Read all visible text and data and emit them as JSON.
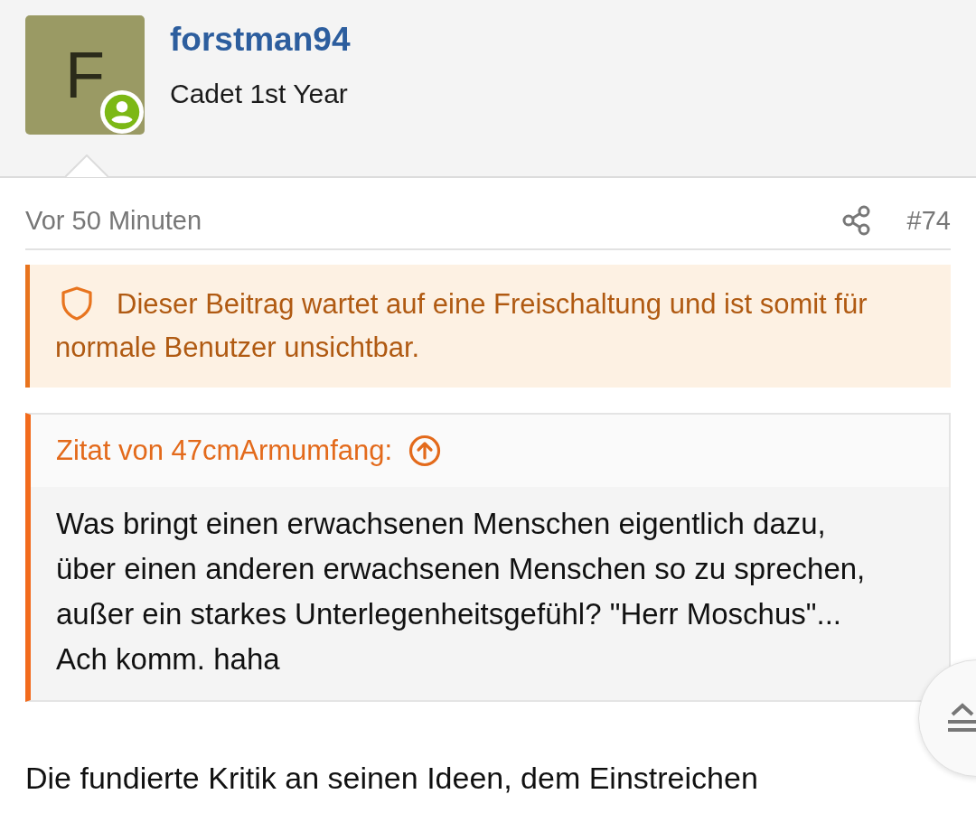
{
  "author": {
    "avatar_letter": "F",
    "online": true,
    "name": "forstman94",
    "rank": "Cadet 1st Year"
  },
  "post": {
    "time": "Vor 50 Minuten",
    "number": "#74",
    "notice": "Dieser Beitrag wartet auf eine Freischaltung und ist somit für normale Benutzer unsichtbar.",
    "quote": {
      "source": "Zitat von 47cmArmumfang:",
      "text": "Was bringt einen erwachsenen Menschen eigentlich dazu, über einen anderen erwachsenen Menschen so zu sprechen, außer ein starkes Unterlegenheitsgefühl? \"Herr Moschus\"... Ach komm. haha"
    },
    "text": "Die fundierte Kritik an seinen Ideen, dem Einstreichen"
  }
}
